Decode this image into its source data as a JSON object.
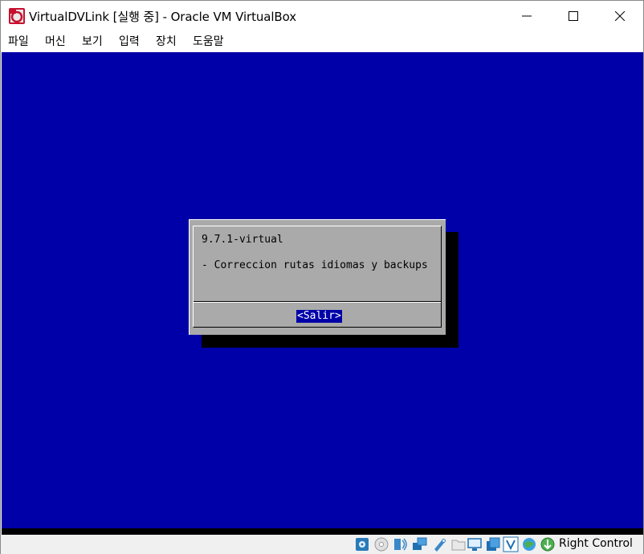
{
  "window": {
    "title": "VirtualDVLink [실행 중] - Oracle VM VirtualBox",
    "controls": {
      "minimize": "minimize",
      "maximize": "maximize",
      "close": "close"
    }
  },
  "menubar": {
    "items": [
      "파일",
      "머신",
      "보기",
      "입력",
      "장치",
      "도움말"
    ]
  },
  "vm": {
    "background_color": "#0000a8",
    "dialog": {
      "line1": "9.7.1-virtual",
      "line2": "- Correccion rutas idiomas y backups",
      "button_label": "<Salir>"
    }
  },
  "statusbar": {
    "icons": [
      "hard-disk-icon",
      "optical-drive-icon",
      "audio-icon",
      "network-icon",
      "usb-icon",
      "shared-folders-icon",
      "display-icon",
      "video-capture-icon",
      "virtualization-icon",
      "cpu-icon",
      "mouse-integration-icon"
    ],
    "host_key": "Right Control"
  }
}
